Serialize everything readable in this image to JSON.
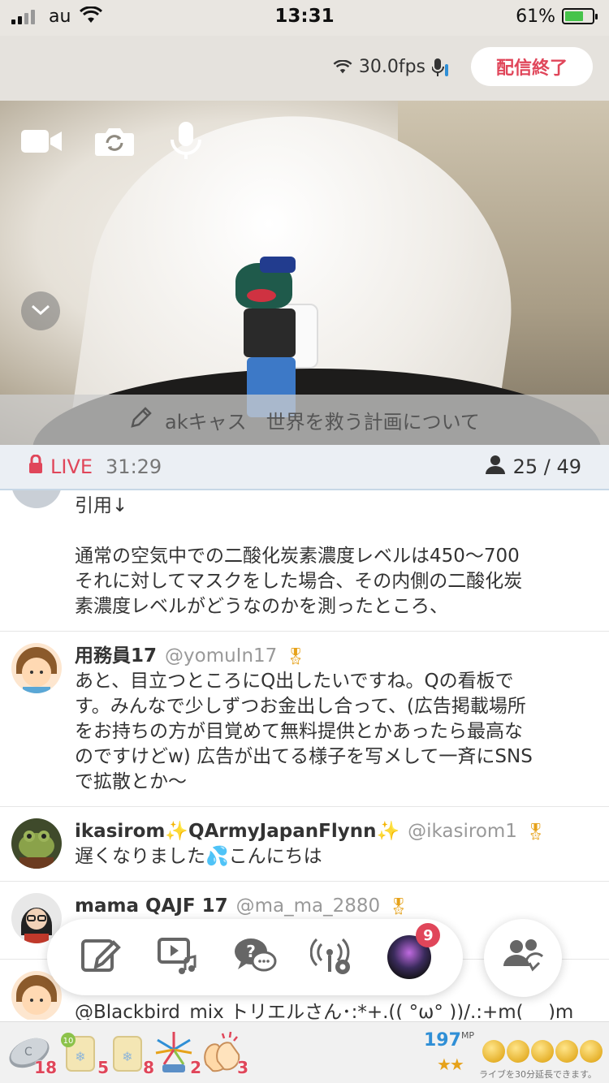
{
  "status_bar": {
    "carrier": "au",
    "time": "13:31",
    "battery": "61%"
  },
  "stream": {
    "fps": "30.0fps",
    "end_label": "配信終了",
    "title": "akキャス　世界を救う計画について"
  },
  "live": {
    "label": "LIVE",
    "elapsed": "31:29",
    "viewers": "25 / 49"
  },
  "comments": [
    {
      "name": "",
      "handle": "",
      "text": "引用↓\n\n通常の空気中での二酸化炭素濃度レベルは450〜700\nそれに対してマスクをした場合、その内側の二酸化炭\n素濃度レベルがどうなのかを測ったところ、"
    },
    {
      "name": "用務員17",
      "handle": "@yomuIn17",
      "text": "あと、目立つところにQ出したいですね。Qの看板で\nす。みんなで少しずつお金出し合って、(広告掲載場所\nをお持ちの方が目覚めて無料提供とかあったら最高な\nのですけどw) 広告が出てる様子を写メして一斉にSNS\nで拡散とか〜"
    },
    {
      "name": "ikasirom✨QArmyJapanFlynn✨",
      "handle": "@ikasirom1",
      "text": "遅くなりました💦こんにちは"
    },
    {
      "name": "mama QAJF 17",
      "handle": "@ma_ma_2880",
      "text": ""
    },
    {
      "name": "",
      "handle": "",
      "text": "@Blackbird_mix トリエルさん･:*+.(( °ω° ))/.:+m(_ _)m"
    }
  ],
  "toolbar": {
    "badge": "9"
  },
  "items": {
    "counts": [
      "18",
      "5",
      "8",
      "2",
      "3"
    ],
    "mp_value": "197",
    "mp_unit": "MP",
    "coin_note": "ライブを30分延長できます。"
  }
}
